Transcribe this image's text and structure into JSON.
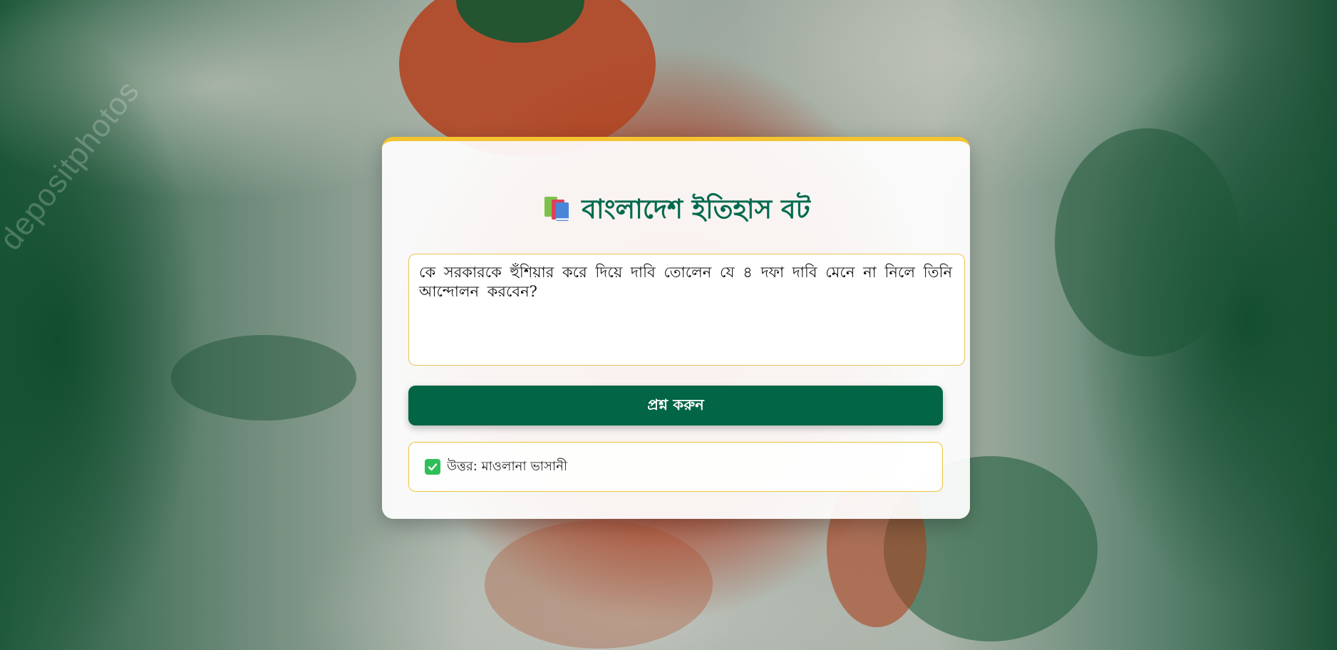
{
  "app": {
    "title": "বাংলাদেশ ইতিহাস বট",
    "title_icon": "books-icon",
    "accent_color": "#006a4e",
    "highlight_color": "#f4c430"
  },
  "background": {
    "watermark": "depositphotos"
  },
  "question": {
    "value": "কে সরকারকে হুঁশিয়ার করে দিয়ে দাবি তোলেন যে ৪ দফা দাবি মেনে না নিলে তিনি আন্দোলন করবেন?"
  },
  "ask_button": {
    "label": "প্রশ্ন করুন",
    "color": "#016546"
  },
  "answer": {
    "icon": "check-box-icon",
    "text": "উত্তর: মাওলানা ভাসানী"
  }
}
